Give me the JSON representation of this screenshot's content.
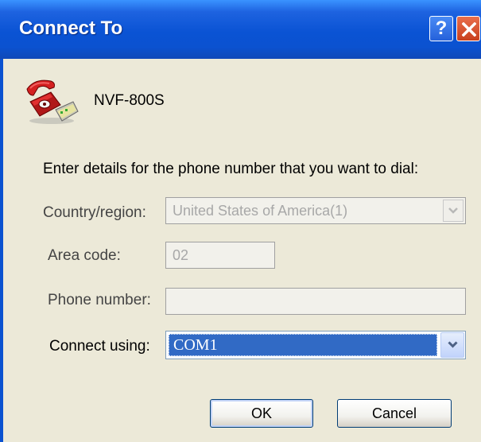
{
  "window": {
    "title": "Connect To",
    "help_label": "?"
  },
  "connection": {
    "name": "NVF-800S"
  },
  "form": {
    "prompt": "Enter details for the phone number that you want to dial:",
    "country_label": "Country/region:",
    "country_value": "United States of America(1)",
    "area_label": "Area code:",
    "area_value": "02",
    "phone_label": "Phone number:",
    "phone_value": "",
    "connect_label": "Connect using:",
    "connect_value": "COM1"
  },
  "buttons": {
    "ok": "OK",
    "cancel": "Cancel"
  },
  "icons": {
    "app": "phone-modem-icon",
    "help": "help-icon",
    "close": "close-icon",
    "dropdown": "chevron-down-icon"
  },
  "colors": {
    "titlebar": "#0B52D0",
    "dialog_bg": "#ECE9D8",
    "selection": "#316AC5",
    "close_button": "#D9552F"
  }
}
